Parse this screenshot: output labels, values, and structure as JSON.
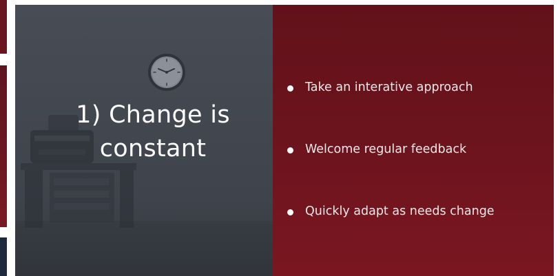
{
  "slide": {
    "title_lines": [
      "1) Change is",
      "constant"
    ],
    "bullets": [
      "Take an interative approach",
      "Welcome regular feedback",
      "Quickly adapt as needs change"
    ]
  },
  "icons": {
    "clock": "clock-icon",
    "desk": "office-desk-printer-illustration"
  },
  "colors": {
    "left_panel": "#434851",
    "right_panel": "#6c141e",
    "text": "#ffffff"
  }
}
